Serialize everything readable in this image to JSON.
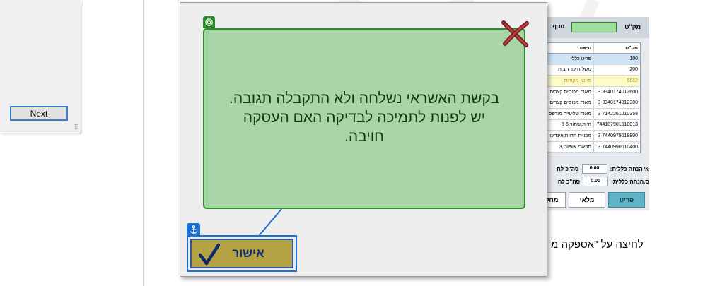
{
  "wizard": {
    "next_label": "Next",
    "grip": "⠿"
  },
  "pos": {
    "sku_label": "מק\"ט",
    "branch_label": "סניף",
    "table_headers": {
      "sku": "מק\"ט",
      "description": "תיאור"
    },
    "rows": [
      {
        "sku": "100",
        "desc": "פריט כללי",
        "style": "hl"
      },
      {
        "sku": "200",
        "desc": "משלוח עד הבית",
        "style": ""
      },
      {
        "sku": "5552",
        "desc": "פינשי מקורות",
        "style": "yl"
      },
      {
        "sku": "3340174013600 3",
        "desc": "מארז מכוסים קצרים",
        "style": ""
      },
      {
        "sku": "3340174012300 3",
        "desc": "מארז מכוסים קצרים",
        "style": ""
      },
      {
        "sku": "7142261010358 3",
        "desc": "מארז שלישיה מודפס",
        "style": ""
      },
      {
        "sku": "744107901010013",
        "desc": "היות,שחור,8-6",
        "style": ""
      },
      {
        "sku": "7440979018800 3",
        "desc": "מכווית הדוות,אינדיגו",
        "style": ""
      },
      {
        "sku": "7440990010400 3",
        "desc": "ספארי אופווט,3",
        "style": ""
      }
    ],
    "discount_pct_label": "% הנחה כללית:",
    "discount_amt_label": "ס.הנחה כללית:",
    "discount_pct_value": "0.00",
    "discount_amt_value": "0.00",
    "total_label_1": "סה\"כ לח",
    "total_label_2": "סה\"כ לח",
    "buttons": {
      "item": "פריט",
      "stock": "מלאי",
      "search": "מחק"
    }
  },
  "caption": "לחיצה על \"אספקה מ",
  "dialog": {
    "message_line1": "בקשת האשראי נשלחה ולא התקבלה תגובה.",
    "message_line2": "יש לפנות לתמיכה לבדיקה האם העסקה חויבה.",
    "ok_label": "אישור",
    "colors": {
      "callout_fill": "#a8d5a8",
      "callout_border": "#2e8b2e",
      "ok_fill": "#b5a245",
      "ok_text": "#0d2a6b"
    }
  },
  "icons": [
    "target-icon",
    "anchor-icon",
    "checkmark-icon",
    "close-x-icon"
  ]
}
